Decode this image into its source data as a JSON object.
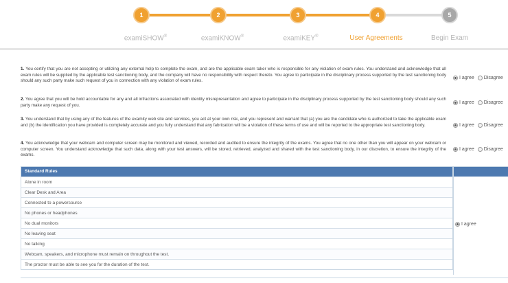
{
  "stepper": {
    "steps": [
      {
        "number": "1",
        "label": "examiSHOW",
        "mark": "®"
      },
      {
        "number": "2",
        "label": "examiKNOW",
        "mark": "®"
      },
      {
        "number": "3",
        "label": "examiKEY",
        "mark": "®"
      },
      {
        "number": "4",
        "label": "User Agreements",
        "mark": ""
      },
      {
        "number": "5",
        "label": "Begin Exam",
        "mark": ""
      }
    ],
    "active_step": 4
  },
  "agreements": [
    {
      "number": "1.",
      "text": "You certify that you are not accepting or utilizing any external help to complete the exam, and are the applicable exam taker who is responsible for any violation of exam rules. You understand and acknowledge that all exam rules will be supplied by the applicable test sanctioning body, and the company will have no responsibility with respect thereto. You agree to participate in the disciplinary process supported by the test sanctioning body should any such party make such request of you in connection with any violation of exam rules.",
      "agree_label": "I agree",
      "disagree_label": "Disagree",
      "selected": "agree"
    },
    {
      "number": "2.",
      "text": "You agree that you will be hold accountable for any and all infractions associated with identity misrepresentation and agree to participate in the disciplinary process supported by the test sanctioning body should any such party make any request of you.",
      "agree_label": "I agree",
      "disagree_label": "Disagree",
      "selected": "agree"
    },
    {
      "number": "3.",
      "text": "You understand that by using any of the features of the examity web site and services, you act at your own risk, and you represent and warrant that (a) you are the candidate who is authorized to take the applicable exam and (b) the identification you have provided is completely accurate and you fully understand that any fabrication will be a violation of these terms of use and will be reported to the appropriate test sanctioning body.",
      "agree_label": "I agree",
      "disagree_label": "Disagree",
      "selected": "agree"
    },
    {
      "number": "4.",
      "text": "You acknowledge that your webcam and computer screen may be monitored and viewed, recorded and audited to ensure the integrity of the exams. You agree that no one other than you will appear on your webcam or computer screen. You understand acknowledge that such data, along with your test answers, will be stored, retrieved, analyzed and shared with the test sanctioning body, in our discretion, to ensure the integrity of the exams.",
      "agree_label": "I agree",
      "disagree_label": "Disagree",
      "selected": "agree"
    }
  ],
  "rules": {
    "header": "Standard Rules",
    "items": [
      "Alone in room",
      "Clear Desk and Area",
      "Connected to a powersource",
      "No phones or headphones",
      "No dual monitors",
      "No leaving seat",
      "No talking",
      "Webcam, speakers, and microphone must remain on throughout the test.",
      "The proctor must be able to see you for the duration of the test."
    ],
    "agree_label": "I agree",
    "selected": "agree"
  },
  "colors": {
    "accent": "#f0a131",
    "inactive_step": "#a8a8a8",
    "table_header": "#4d79b0"
  }
}
